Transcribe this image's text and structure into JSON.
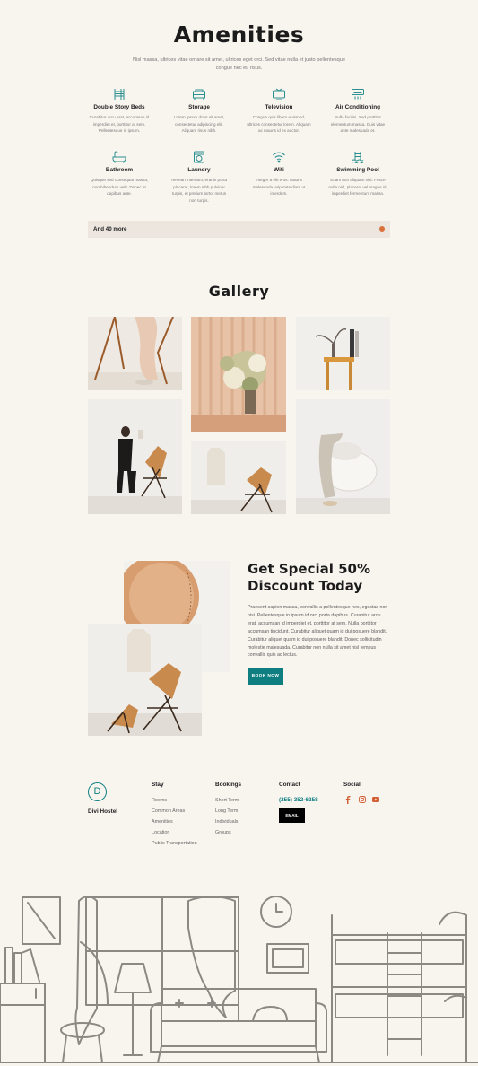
{
  "amenities": {
    "title": "Amenities",
    "subtitle_line1": "Nisl massa, ultrices vitae ornare sit amet, ultrices eget orci. Sed vitae nulla et justo pellentesque",
    "subtitle_line2": "congue nec eu risus.",
    "items": [
      {
        "icon": "bunk-bed-icon",
        "name": "Double Story Beds",
        "desc": [
          "Curabitur arcu erat, accumsan id",
          "imperdiet et, porttitor at sem.",
          "Pellentesque in ipsum."
        ]
      },
      {
        "icon": "storage-icon",
        "name": "Storage",
        "desc": [
          "Lorem ipsum dolor sit amet,",
          "consectetur adipiscing elit.",
          "Aliquam risus nibh."
        ]
      },
      {
        "icon": "television-icon",
        "name": "Television",
        "desc": [
          "Congue quis libero euismod,",
          "ultrices consectetur lorem. Aliquam",
          "ac mauris id ex auctor."
        ]
      },
      {
        "icon": "air-conditioner-icon",
        "name": "Air Conditioning",
        "desc": [
          "Nulla facilisi. Sed porttitor",
          "elementum massa. Duis vitae",
          "ante malesuada et."
        ]
      },
      {
        "icon": "bathtub-icon",
        "name": "Bathroom",
        "desc": [
          "Quisque sed consequat massa,",
          "non bibendum velit. Donec et",
          "dapibus ante."
        ]
      },
      {
        "icon": "washing-machine-icon",
        "name": "Laundry",
        "desc": [
          "Aenean interdum, erat in porta",
          "placerat, lorem nibh pulvinar",
          "turpis, et pretium tortor metus",
          "non turpis."
        ]
      },
      {
        "icon": "wifi-icon",
        "name": "Wifi",
        "desc": [
          "Integer a elit eros. Mauris",
          "malesuada vulputate diam ut",
          "interdum."
        ]
      },
      {
        "icon": "swimming-pool-icon",
        "name": "Swimming Pool",
        "desc": [
          "Etiam non aliquam nisl. Fusce",
          "nulla nisl, placerat vel magna id,",
          "imperdiet fermentum massa."
        ]
      }
    ],
    "more_label": "And 40 more"
  },
  "gallery": {
    "title": "Gallery"
  },
  "promo": {
    "heading_line1": "Get Special 50%",
    "heading_line2": "Discount Today",
    "body": [
      "Praesent sapien massa, convallis a pellentesque nec, egestas non",
      "nisi. Pellentesque in ipsum id orci porta dapibus. Curabitur arcu",
      "erat, accumsan id imperdiet et, porttitor at sem. Nulla porttitor",
      "accumsan tincidunt. Curabitur aliquet quam id dui posuere blandit.",
      "Curabitur aliquet quam id dui posuere blandit. Donec sollicitudin",
      "molestie malesuada. Curabitur non nulla sit amet nisl tempus",
      "convallis quis ac lectus."
    ],
    "button_label": "BOOK NOW"
  },
  "footer": {
    "brand_letter": "D",
    "brand_name": "Divi Hostel",
    "stay": {
      "title": "Stay",
      "links": [
        "Rooms",
        "Common Areas",
        "Amenities",
        "Location",
        "Public Transportation"
      ]
    },
    "bookings": {
      "title": "Bookings",
      "links": [
        "Short Term",
        "Long Term",
        "Individuals",
        "Groups"
      ]
    },
    "contact": {
      "title": "Contact",
      "phone": "(255) 352-6258",
      "email_label": "EMAIL"
    },
    "social": {
      "title": "Social",
      "icons": [
        "facebook-icon",
        "instagram-icon",
        "youtube-icon"
      ]
    }
  },
  "colors": {
    "background": "#f8f5ef",
    "teal": "#0e7e80",
    "accent_orange": "#d9713a",
    "social_orange": "#d35f35"
  }
}
